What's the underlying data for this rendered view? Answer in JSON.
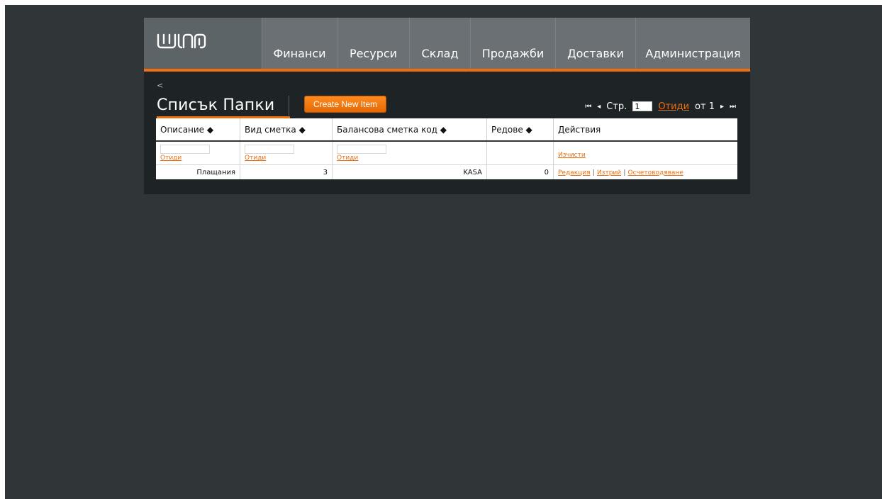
{
  "nav": [
    "Финанси",
    "Ресурси",
    "Склад",
    "Продажби",
    "Доставки",
    "Администрация"
  ],
  "back": "<",
  "page_title": "Списък Папки",
  "create_button": "Create New Item",
  "pager": {
    "first_icon": "⏮",
    "prev_icon": "◂",
    "page_label": "Стр.",
    "page_value": "1",
    "go_label": "Отиди",
    "of_label": "от 1",
    "next_icon": "▸",
    "last_icon": "⏭"
  },
  "table": {
    "headers": [
      "Описание ◆",
      "Вид сметка ◆",
      "Балансова сметка код ◆",
      "Редове ◆",
      "Действия"
    ],
    "filter_link": "Отиди",
    "clear_link": "Изчисти",
    "rows": [
      {
        "description": "Плащания",
        "type": "3",
        "account_code": "KASA",
        "lines": "0",
        "actions": [
          "Редакция",
          "Изтрий",
          "Осчетоводяване"
        ]
      }
    ]
  },
  "colors": {
    "accent": "#ee6e10",
    "background": "#303538",
    "panel": "#1e2326"
  }
}
